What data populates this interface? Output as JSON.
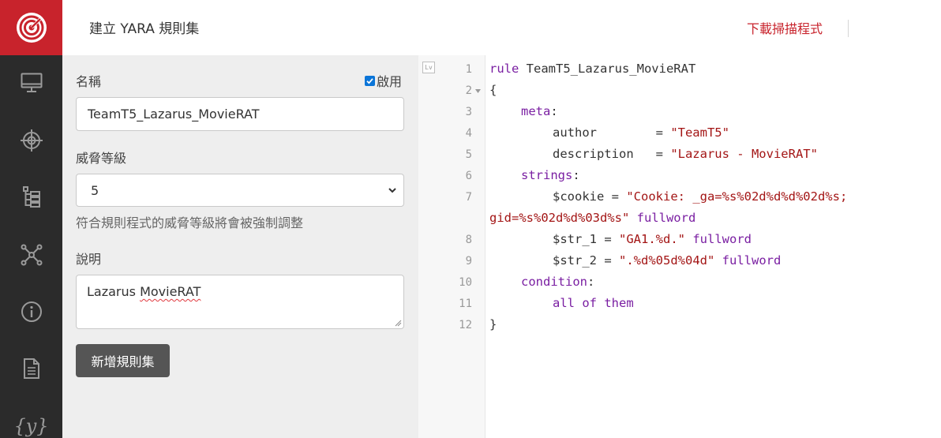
{
  "header": {
    "title": "建立 YARA 規則集",
    "download_label": "下載掃描程式"
  },
  "sidebar": {
    "items": [
      {
        "icon": "monitor-icon"
      },
      {
        "icon": "crosshair-icon"
      },
      {
        "icon": "tree-list-icon"
      },
      {
        "icon": "network-icon"
      },
      {
        "icon": "info-icon"
      },
      {
        "icon": "document-icon"
      },
      {
        "icon": "yara-braces-icon",
        "glyph": "{y}"
      }
    ]
  },
  "form": {
    "name_label": "名稱",
    "enable_label": "啟用",
    "enable_checked": true,
    "name_value": "TeamT5_Lazarus_MovieRAT",
    "threat_label": "威脅等級",
    "threat_value": "5",
    "threat_hint": "符合規則程式的威脅等級將會被強制調整",
    "desc_label": "說明",
    "desc_value_prefix": "Lazarus ",
    "desc_value_flagged": "MovieRAT",
    "submit_label": "新增規則集"
  },
  "editor": {
    "line_numbers": [
      "1",
      "2",
      "3",
      "4",
      "5",
      "6",
      "7",
      "8",
      "9",
      "10",
      "11",
      "12"
    ],
    "lines": {
      "l1_kw": "rule",
      "l1_name": " TeamT5_Lazarus_MovieRAT",
      "l2": "{",
      "l3_kw": "meta",
      "l3_colon": ":",
      "l4_key": "author        = ",
      "l4_val": "\"TeamT5\"",
      "l5_key": "description   = ",
      "l5_val": "\"Lazarus - MovieRAT\"",
      "l6_kw": "strings",
      "l6_colon": ":",
      "l7_key": "$cookie = ",
      "l7_val_a": "\"Cookie: _ga=%s%02d%d%d%02d%s;",
      "l7_val_b": "gid=%s%02d%d%03d%s\"",
      "l7_mod": " fullword",
      "l8_key": "$str_1 = ",
      "l8_val": "\"GA1.%d.\"",
      "l8_mod": " fullword",
      "l9_key": "$str_2 = ",
      "l9_val": "\".%d%05d%04d\"",
      "l9_mod": " fullword",
      "l10_kw": "condition",
      "l10_colon": ":",
      "l11_kw": "all of them",
      "l12": "}"
    }
  },
  "colors": {
    "brand_red": "#c8232c",
    "sidebar_bg": "#2b2b2b",
    "keyword": "#7a1fa2",
    "string": "#a31515"
  }
}
